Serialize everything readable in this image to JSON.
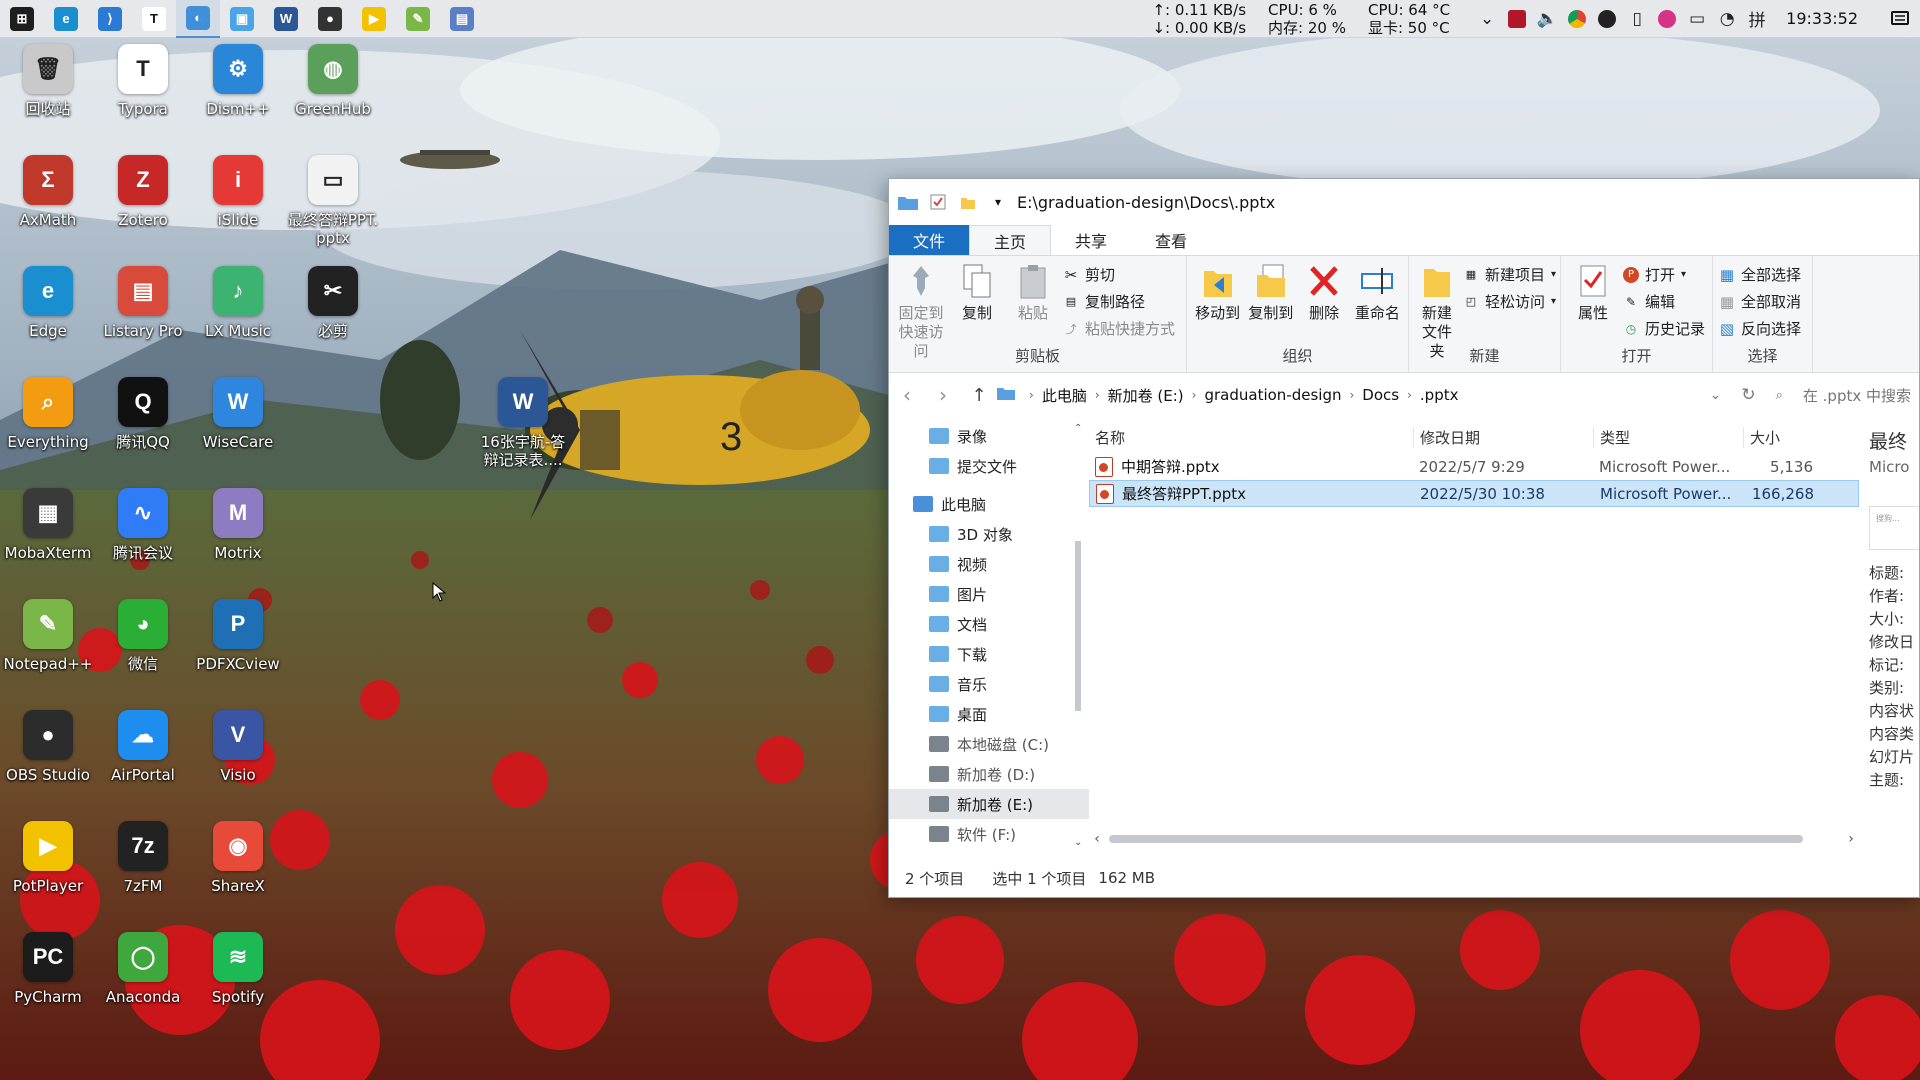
{
  "taskbar": {
    "apps": [
      {
        "name": "windows-start",
        "color": "#1e1e1e",
        "glyph": "⊞"
      },
      {
        "name": "edge",
        "color": "#1a8fd0",
        "glyph": "e"
      },
      {
        "name": "vscode",
        "color": "#2b7bd4",
        "glyph": "⟩"
      },
      {
        "name": "typora",
        "color": "#ffffff",
        "glyph": "T"
      },
      {
        "name": "file-explorer",
        "color": "#3f8fdb",
        "glyph": "◐"
      },
      {
        "name": "sandbox",
        "color": "#4aa5e8",
        "glyph": "▣"
      },
      {
        "name": "word",
        "color": "#2b5797",
        "glyph": "W"
      },
      {
        "name": "obs",
        "color": "#333333",
        "glyph": "●"
      },
      {
        "name": "potplayer",
        "color": "#f2c200",
        "glyph": "▶"
      },
      {
        "name": "notepad-plus",
        "color": "#7ab648",
        "glyph": "✎"
      },
      {
        "name": "listary",
        "color": "#5a7fc7",
        "glyph": "▤"
      }
    ],
    "net_up": "↑: 0.11 KB/s",
    "net_down": "↓: 0.00 KB/s",
    "cpu_usage": "CPU: 6 %",
    "mem_usage": "内存: 20 %",
    "cpu_temp": "CPU: 64 °C",
    "gpu_temp": "显卡: 50 °C",
    "clock": "19:33:52"
  },
  "desktop": {
    "icons": [
      {
        "label": "回收站",
        "color": "#c9c9c9",
        "glyph": "🗑"
      },
      {
        "label": "Typora",
        "color": "#ffffff",
        "glyph": "T"
      },
      {
        "label": "Dism++",
        "color": "#2a86d6",
        "glyph": "⚙"
      },
      {
        "label": "GreenHub",
        "color": "#5aa05a",
        "glyph": "◍"
      },
      {
        "label": "AxMath",
        "color": "#c0392b",
        "glyph": "Σ"
      },
      {
        "label": "Zotero",
        "color": "#c62828",
        "glyph": "Z"
      },
      {
        "label": "iSlide",
        "color": "#e53935",
        "glyph": "i"
      },
      {
        "label": "最终答辩PPT.pptx",
        "color": "#f2f2f2",
        "glyph": "▭"
      },
      {
        "label": "Edge",
        "color": "#1a8fd0",
        "glyph": "e"
      },
      {
        "label": "Listary Pro",
        "color": "#d84a3a",
        "glyph": "▤"
      },
      {
        "label": "LX Music",
        "color": "#3cb371",
        "glyph": "♪"
      },
      {
        "label": "必剪",
        "color": "#222222",
        "glyph": "✂"
      },
      {
        "label": "Everything",
        "color": "#f39c12",
        "glyph": "⌕"
      },
      {
        "label": "腾讯QQ",
        "color": "#111111",
        "glyph": "Q"
      },
      {
        "label": "WiseCare",
        "color": "#2e86de",
        "glyph": "W"
      },
      {
        "label": "16张宇航-答辩记录表....",
        "color": "#2b5797",
        "glyph": "W"
      },
      {
        "label": "MobaXterm",
        "color": "#3a3a3a",
        "glyph": "▦"
      },
      {
        "label": "腾讯会议",
        "color": "#2f7cf6",
        "glyph": "∿"
      },
      {
        "label": "Motrix",
        "color": "#8e7cc3",
        "glyph": "M"
      },
      {
        "label": "Notepad++",
        "color": "#7ab648",
        "glyph": "✎"
      },
      {
        "label": "微信",
        "color": "#2bae35",
        "glyph": "◕"
      },
      {
        "label": "PDFXCview",
        "color": "#1f6fb5",
        "glyph": "P"
      },
      {
        "label": "OBS Studio",
        "color": "#2c2c2c",
        "glyph": "●"
      },
      {
        "label": "AirPortal",
        "color": "#1d8ef0",
        "glyph": "☁"
      },
      {
        "label": "Visio",
        "color": "#3955a3",
        "glyph": "V"
      },
      {
        "label": "PotPlayer",
        "color": "#f2c200",
        "glyph": "▶"
      },
      {
        "label": "7zFM",
        "color": "#222222",
        "glyph": "7z"
      },
      {
        "label": "ShareX",
        "color": "#e84a3a",
        "glyph": "◉"
      },
      {
        "label": "PyCharm",
        "color": "#1c1c1c",
        "glyph": "PC"
      },
      {
        "label": "Anaconda",
        "color": "#3ea83e",
        "glyph": "◯"
      },
      {
        "label": "Spotify",
        "color": "#1db954",
        "glyph": "≋"
      }
    ]
  },
  "explorer": {
    "title": "E:\\graduation-design\\Docs\\.pptx",
    "tabs": [
      "文件",
      "主页",
      "共享",
      "查看"
    ],
    "ribbon": {
      "clipboard": {
        "title": "剪贴板",
        "pin": "固定到快速访问",
        "copy": "复制",
        "paste": "粘贴",
        "cut": "剪切",
        "copy_path": "复制路径",
        "paste_shortcut": "粘贴快捷方式"
      },
      "organize": {
        "title": "组织",
        "move_to": "移动到",
        "copy_to": "复制到",
        "delete": "删除",
        "rename": "重命名"
      },
      "new": {
        "title": "新建",
        "new_folder": "新建文件夹",
        "new_item": "新建项目",
        "easy_access": "轻松访问"
      },
      "open": {
        "title": "打开",
        "properties": "属性",
        "open": "打开",
        "edit": "编辑",
        "history": "历史记录"
      },
      "select": {
        "title": "选择",
        "select_all": "全部选择",
        "select_none": "全部取消",
        "invert": "反向选择"
      }
    },
    "breadcrumb": [
      "此电脑",
      "新加卷 (E:)",
      "graduation-design",
      "Docs",
      ".pptx"
    ],
    "search_placeholder": "在 .pptx 中搜索",
    "nav_items": [
      {
        "label": "录像",
        "kind": "folder"
      },
      {
        "label": "提交文件",
        "kind": "folder"
      },
      {
        "label": "此电脑",
        "kind": "pc"
      },
      {
        "label": "3D 对象",
        "kind": "folder"
      },
      {
        "label": "视频",
        "kind": "folder"
      },
      {
        "label": "图片",
        "kind": "folder"
      },
      {
        "label": "文档",
        "kind": "folder"
      },
      {
        "label": "下载",
        "kind": "folder"
      },
      {
        "label": "音乐",
        "kind": "folder"
      },
      {
        "label": "桌面",
        "kind": "folder"
      },
      {
        "label": "本地磁盘 (C:)",
        "kind": "drive"
      },
      {
        "label": "新加卷 (D:)",
        "kind": "drive"
      },
      {
        "label": "新加卷 (E:)",
        "kind": "drive",
        "selected": true
      },
      {
        "label": "软件 (F:)",
        "kind": "drive"
      }
    ],
    "columns": {
      "name": "名称",
      "modified": "修改日期",
      "type": "类型",
      "size": "大小"
    },
    "files": [
      {
        "name": "中期答辩.pptx",
        "modified": "2022/5/7 9:29",
        "type": "Microsoft Power...",
        "size": "5,136",
        "selected": false
      },
      {
        "name": "最终答辩PPT.pptx",
        "modified": "2022/5/30 10:38",
        "type": "Microsoft Power...",
        "size": "166,268",
        "selected": true
      }
    ],
    "preview": {
      "title": "最终",
      "app": "Micro",
      "thumb_text": "搜狗...",
      "fields": [
        "标题:",
        "作者:",
        "大小:",
        "修改日",
        "标记:",
        "类别:",
        "内容状",
        "内容类",
        "幻灯片",
        "主题:"
      ]
    },
    "status": {
      "count": "2 个项目",
      "selected": "选中 1 个项目",
      "size": "162 MB"
    }
  }
}
